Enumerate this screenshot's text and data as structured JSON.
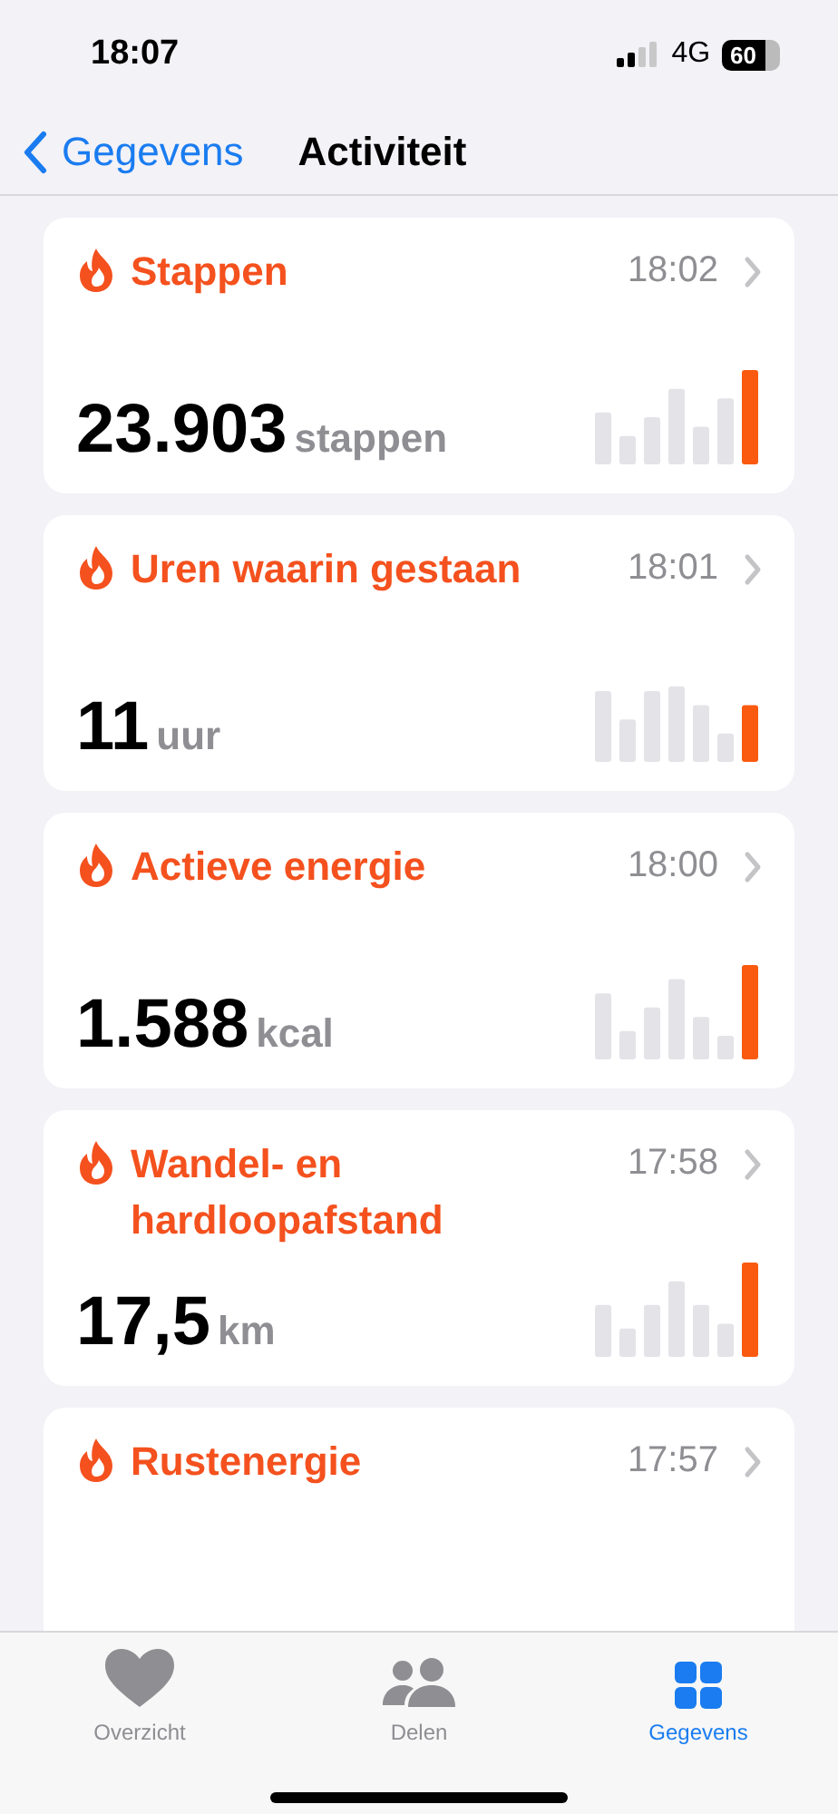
{
  "status_bar": {
    "time": "18:07",
    "network": "4G",
    "battery": "60"
  },
  "nav": {
    "back": "Gegevens",
    "title": "Activiteit"
  },
  "cards": [
    {
      "title": "Stappen",
      "time": "18:02",
      "value": "23.903",
      "unit": "stappen"
    },
    {
      "title": "Uren waarin gestaan",
      "time": "18:01",
      "value": "11",
      "unit": "uur"
    },
    {
      "title": "Actieve energie",
      "time": "18:00",
      "value": "1.588",
      "unit": "kcal"
    },
    {
      "title": "Wandel- en hardloopafstand",
      "time": "17:58",
      "value": "17,5",
      "unit": "km"
    },
    {
      "title": "Rustenergie",
      "time": "17:57"
    }
  ],
  "tabs": [
    {
      "label": "Overzicht",
      "kind": "heart",
      "selected": false
    },
    {
      "label": "Delen",
      "kind": "people",
      "selected": false
    },
    {
      "label": "Gegevens",
      "kind": "grid",
      "selected": true
    }
  ]
}
